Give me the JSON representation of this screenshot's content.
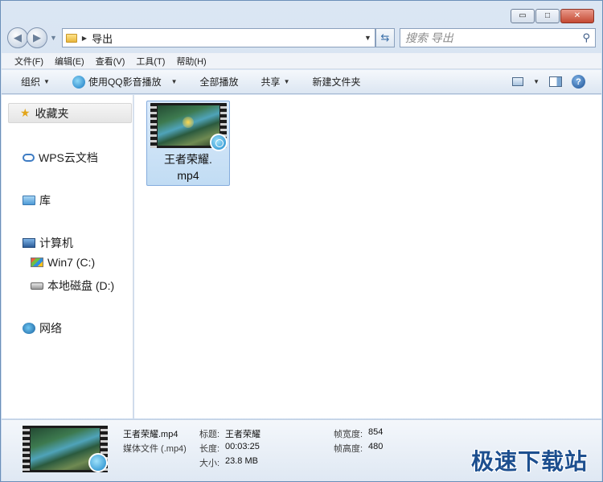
{
  "window": {
    "caption_minimize": "▭",
    "caption_maximize": "□",
    "caption_close": "✕"
  },
  "address": {
    "path": "导出"
  },
  "search": {
    "placeholder": "搜索 导出"
  },
  "menu": {
    "items": [
      "文件(F)",
      "编辑(E)",
      "查看(V)",
      "工具(T)",
      "帮助(H)"
    ]
  },
  "commands": {
    "organize": "组织",
    "play_with": "使用QQ影音播放",
    "play_all": "全部播放",
    "share": "共享",
    "new_folder": "新建文件夹"
  },
  "nav": {
    "favorites": "收藏夹",
    "wps": "WPS云文档",
    "libraries": "库",
    "computer": "计算机",
    "drive_c": "Win7 (C:)",
    "drive_d": "本地磁盘 (D:)",
    "network": "网络"
  },
  "file": {
    "label": "王者荣耀.\nmp4"
  },
  "details": {
    "name": "王者荣耀.mp4",
    "type": "媒体文件 (.mp4)",
    "title_label": "标题:",
    "title_value": "王者荣耀",
    "length_label": "长度:",
    "length_value": "00:03:25",
    "size_label": "大小:",
    "size_value": "23.8 MB",
    "width_label": "帧宽度:",
    "width_value": "854",
    "height_label": "帧高度:",
    "height_value": "480"
  },
  "watermark": "极速下载站",
  "icons": {
    "back": "back-arrow-icon",
    "forward": "forward-arrow-icon",
    "search": "magnifier-icon",
    "refresh": "refresh-icon",
    "help": "help-icon"
  }
}
